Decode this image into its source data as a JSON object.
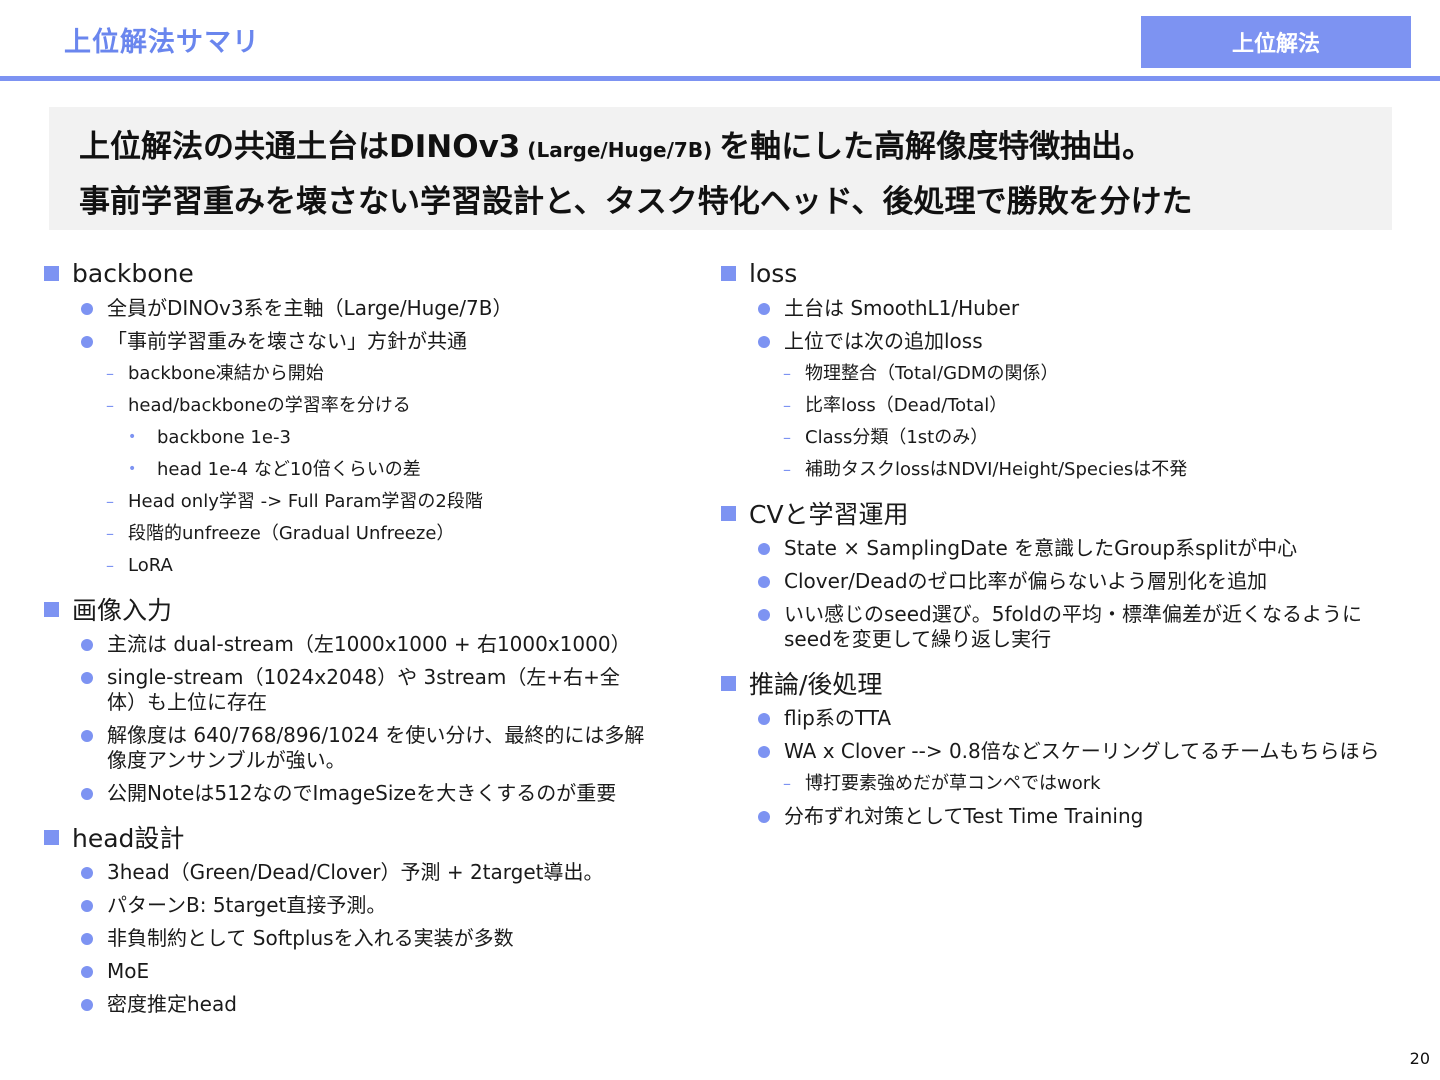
{
  "header": {
    "title": "上位解法サマリ",
    "tag": "上位解法"
  },
  "headline": {
    "line1_a": "上位解法の共通土台はDINOv3",
    "line1_small": " (Large/Huge/7B) ",
    "line1_b": "を軸にした高解像度特徴抽出。",
    "line2": "事前学習重みを壊さない学習設計と、タスク特化ヘッド、後処理で勝敗を分けた"
  },
  "left": {
    "backbone": {
      "title": "backbone",
      "b1_0": "全員がDINOv3系を主軸（Large/Huge/7B）",
      "b1_1": "「事前学習重みを壊さない」方針が共通",
      "s_0": "backbone凍結から開始",
      "s_1": "head/backboneの学習率を分ける",
      "t_0": "backbone 1e-3",
      "t_1": "head 1e-4 など10倍くらいの差",
      "s_2": "Head only学習 -> Full Param学習の2段階",
      "s_3": "段階的unfreeze（Gradual Unfreeze）",
      "s_4": "LoRA"
    },
    "image_input": {
      "title": "画像入力",
      "b_0": "主流は dual-stream（左1000x1000 + 右1000x1000）",
      "b_1a": "single-stream（1024x2048）や 3stream（左+右+全",
      "b_1b": "体）も上位に存在",
      "b_2a": "解像度は 640/768/896/1024 を使い分け、最終的には多解",
      "b_2b": "像度アンサンブルが強い。",
      "b_3": "公開Noteは512なのでImageSizeを大きくするのが重要"
    },
    "head_design": {
      "title": " head設計",
      "b_0": "3head（Green/Dead/Clover）予測 + 2target導出。",
      "b_1": "パターンB: 5target直接予測。",
      "b_2": "非負制約として Softplusを入れる実装が多数",
      "b_3": "MoE",
      "b_4": "密度推定head"
    }
  },
  "right": {
    "loss": {
      "title": "loss",
      "b_0": "土台は SmoothL1/Huber",
      "b_1": "上位では次の追加loss",
      "s_0": "物理整合（Total/GDMの関係）",
      "s_1": "比率loss（Dead/Total）",
      "s_2": "Class分類（1stのみ）",
      "s_3": "補助タスクlossはNDVI/Height/Speciesは不発"
    },
    "cv": {
      "title": "CVと学習運用",
      "b_0": "State × SamplingDate を意識したGroup系splitが中心",
      "b_1": "Clover/Deadのゼロ比率が偏らないよう層別化を追加",
      "b_2a": "いい感じのseed選び。5foldの平均・標準偏差が近くなるように",
      "b_2b": "seedを変更して繰り返し実行"
    },
    "inference": {
      "title": "推論/後処理",
      "b_0": "flip系のTTA",
      "b_1": "WA x Clover --> 0.8倍などスケーリングしてるチームもちらほら",
      "s_0": "博打要素強めだが草コンペではwork",
      "b_2": "分布ずれ対策としてTest Time Training"
    }
  },
  "page_number": "20",
  "colors": {
    "accent": "#7d93f2",
    "title": "#6a86ee",
    "headline_bg": "#f2f2f2"
  }
}
